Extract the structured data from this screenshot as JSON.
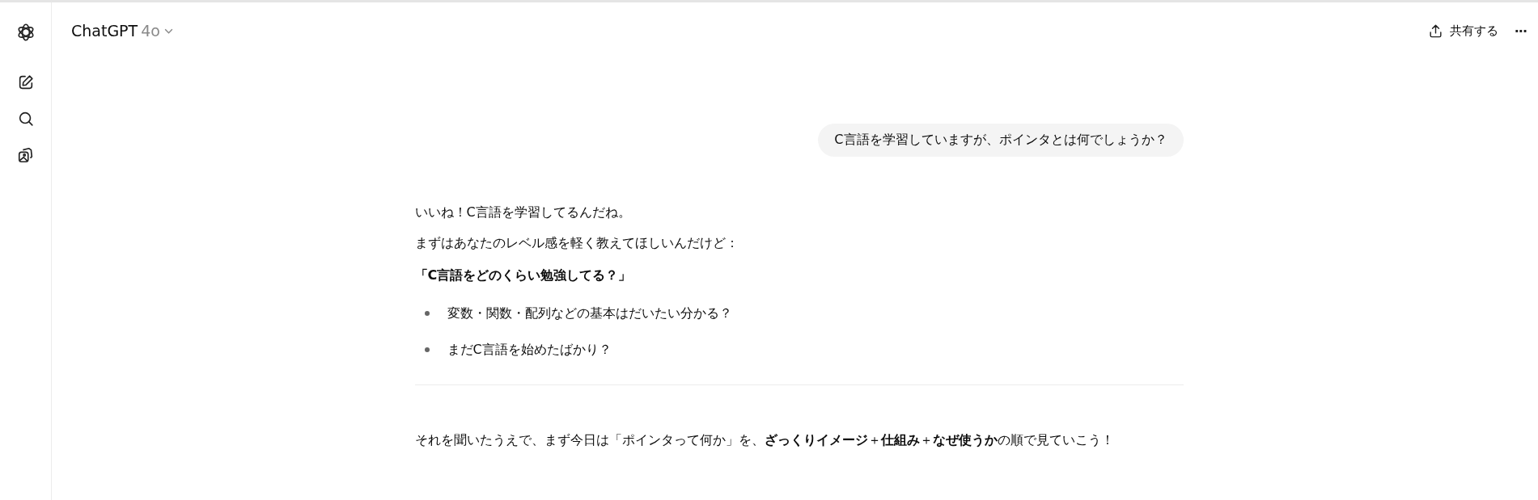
{
  "header": {
    "title": "ChatGPT",
    "model": "4o",
    "share_label": "共有する",
    "more_label": "···"
  },
  "user_message": "C言語を学習していますが、ポインタとは何でしょうか？",
  "assistant": {
    "lines": [
      "いいね！C言語を学習してるんだね。",
      "まずはあなたのレベル感を軽く教えてほしいんだけど："
    ],
    "question": "「C言語をどのくらい勉強してる？」",
    "bullets": [
      "変数・関数・配列などの基本はだいたい分かる？",
      "まだC言語を始めたばかり？"
    ],
    "followup": "それを聞いたうえで、まず今日は「ポインタって何か」を、**ざっくりイメージ**＋**仕組み**＋**なぜ使うか**の順で見ていこう！"
  }
}
